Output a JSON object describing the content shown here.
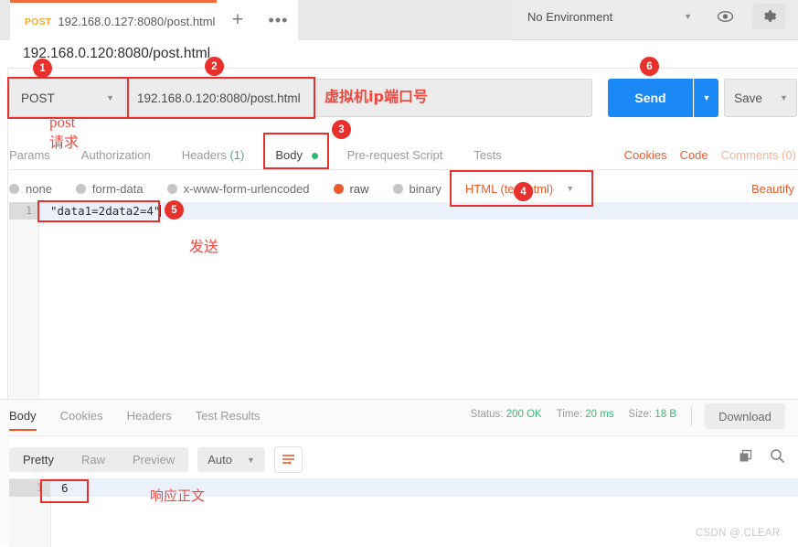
{
  "tabbar": {
    "request_tab": {
      "method": "POST",
      "url": "192.168.0.127:8080/post.html",
      "unsaved_icon": "unsaved-dot"
    },
    "new_tab_icon": "plus-icon",
    "more_icon": "ellipsis-icon",
    "environment": {
      "selected": "No Environment",
      "caret_icon": "chevron-down-icon"
    },
    "eye_icon": "eye-icon",
    "gear_icon": "gear-icon"
  },
  "request": {
    "name": "192.168.0.120:8080/post.html",
    "method": "POST",
    "method_caret_icon": "chevron-down-icon",
    "url": "192.168.0.120:8080/post.html",
    "send_label": "Send",
    "send_caret_icon": "chevron-down-icon",
    "save_label": "Save",
    "save_caret_icon": "chevron-down-icon",
    "tabs": [
      {
        "label": "Params",
        "count": ""
      },
      {
        "label": "Authorization",
        "count": ""
      },
      {
        "label": "Headers",
        "count": "(1)"
      },
      {
        "label": "Body",
        "count": ""
      },
      {
        "label": "Pre-request Script",
        "count": ""
      },
      {
        "label": "Tests",
        "count": ""
      }
    ],
    "links": {
      "cookies": "Cookies",
      "code": "Code",
      "comments": "Comments (0)"
    },
    "body_types": [
      {
        "label": "none",
        "selected": false
      },
      {
        "label": "form-data",
        "selected": false
      },
      {
        "label": "x-www-form-urlencoded",
        "selected": false
      },
      {
        "label": "raw",
        "selected": true
      },
      {
        "label": "binary",
        "selected": false
      }
    ],
    "content_type": "HTML (text/html)",
    "content_type_caret_icon": "chevron-down-icon",
    "beautify_label": "Beautify",
    "body_line_number": "1",
    "body_text": "\"data1=2data2=4\""
  },
  "response": {
    "tabs": [
      "Body",
      "Cookies",
      "Headers",
      "Test Results"
    ],
    "active_tab": "Body",
    "status_label": "Status:",
    "status_value": "200 OK",
    "time_label": "Time:",
    "time_value": "20 ms",
    "size_label": "Size:",
    "size_value": "18 B",
    "download_label": "Download",
    "view_modes": [
      "Pretty",
      "Raw",
      "Preview"
    ],
    "active_view": "Pretty",
    "format": "Auto",
    "format_caret_icon": "chevron-down-icon",
    "wrap_icon": "word-wrap-icon",
    "copy_icon": "copy-icon",
    "search_icon": "search-icon",
    "body_line_number": "1",
    "body_text": "6"
  },
  "annotations": {
    "badges": [
      "1",
      "2",
      "3",
      "4",
      "5",
      "6"
    ],
    "notes": [
      {
        "id": "note-post-request",
        "text_line1": "post",
        "text_line2": "请求"
      },
      {
        "id": "note-vm-ip-port",
        "text": "虚拟机ip端口号"
      },
      {
        "id": "note-send",
        "text": "发送"
      },
      {
        "id": "note-response-body",
        "text": "响应正文"
      }
    ]
  },
  "watermark": "CSDN @.CLEAR.",
  "colors": {
    "accent_orange": "#f05a28",
    "send_blue": "#1a88f5",
    "annotation_red": "#e8312c",
    "success_green": "#3bb87a",
    "method_yellow": "#f0a82e"
  }
}
